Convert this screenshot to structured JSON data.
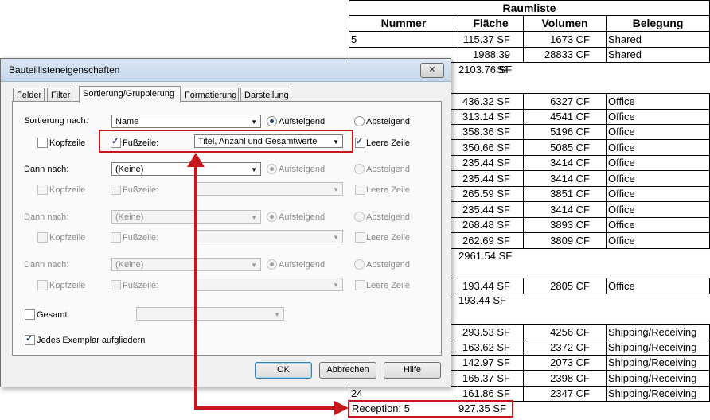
{
  "schedule": {
    "title": "Raumliste",
    "headers": [
      "Nummer",
      "Fläche",
      "Volumen",
      "Belegung"
    ],
    "rows": [
      {
        "nummer": "5",
        "flaeche": "115.37 SF",
        "volumen": "1673 CF",
        "belegung": "Shared"
      },
      {
        "nummer": "",
        "flaeche": "1988.39 SF",
        "volumen": "28833 CF",
        "belegung": "Shared"
      }
    ],
    "sum1": {
      "flaeche": "2103.76 SF"
    },
    "rows2": [
      {
        "nummer": "",
        "flaeche": "436.32 SF",
        "volumen": "6327 CF",
        "belegung": "Office"
      },
      {
        "nummer": "",
        "flaeche": "313.14 SF",
        "volumen": "4541 CF",
        "belegung": "Office"
      },
      {
        "nummer": "",
        "flaeche": "358.36 SF",
        "volumen": "5196 CF",
        "belegung": "Office"
      },
      {
        "nummer": "",
        "flaeche": "350.66 SF",
        "volumen": "5085 CF",
        "belegung": "Office"
      },
      {
        "nummer": "",
        "flaeche": "235.44 SF",
        "volumen": "3414 CF",
        "belegung": "Office"
      },
      {
        "nummer": "",
        "flaeche": "235.44 SF",
        "volumen": "3414 CF",
        "belegung": "Office"
      },
      {
        "nummer": "",
        "flaeche": "265.59 SF",
        "volumen": "3851 CF",
        "belegung": "Office"
      },
      {
        "nummer": "",
        "flaeche": "235.44 SF",
        "volumen": "3414 CF",
        "belegung": "Office"
      },
      {
        "nummer": "",
        "flaeche": "268.48 SF",
        "volumen": "3893 CF",
        "belegung": "Office"
      },
      {
        "nummer": "",
        "flaeche": "262.69 SF",
        "volumen": "3809 CF",
        "belegung": "Office"
      }
    ],
    "sum2": {
      "flaeche": "2961.54 SF"
    },
    "rows3": [
      {
        "nummer": "",
        "flaeche": "193.44 SF",
        "volumen": "2805 CF",
        "belegung": "Office"
      }
    ],
    "sum3": {
      "flaeche": "193.44 SF"
    },
    "rows4": [
      {
        "nummer": "",
        "flaeche": "293.53 SF",
        "volumen": "4256 CF",
        "belegung": "Shipping/Receiving"
      },
      {
        "nummer": "",
        "flaeche": "163.62 SF",
        "volumen": "2372 CF",
        "belegung": "Shipping/Receiving"
      },
      {
        "nummer": "",
        "flaeche": "142.97 SF",
        "volumen": "2073 CF",
        "belegung": "Shipping/Receiving"
      },
      {
        "nummer": "",
        "flaeche": "165.37 SF",
        "volumen": "2398 CF",
        "belegung": "Shipping/Receiving"
      },
      {
        "nummer": "24",
        "flaeche": "161.86 SF",
        "volumen": "2347 CF",
        "belegung": "Shipping/Receiving"
      }
    ],
    "sum4": {
      "label": "Reception: 5",
      "flaeche": "927.35 SF"
    }
  },
  "dialog": {
    "title": "Bauteillisteneigenschaften",
    "close_icon": "close-icon",
    "tabs": [
      "Felder",
      "Filter",
      "Sortierung/Gruppierung",
      "Formatierung",
      "Darstellung"
    ],
    "active_tab": "Sortierung/Gruppierung",
    "sort_label": "Sortierung nach:",
    "then_label": "Dann nach:",
    "header_label": "Kopfzeile",
    "footer_label": "Fußzeile:",
    "blank_label": "Leere Zeile",
    "asc_label": "Aufsteigend",
    "desc_label": "Absteigend",
    "sort1": {
      "field": "Name",
      "footer_checked": true,
      "header_checked": false,
      "blank_checked": true,
      "footer_option": "Titel, Anzahl und Gesamtwerte"
    },
    "none_option": "(Keine)",
    "grand_total_label": "Gesamt:",
    "itemize_label": "Jedes Exemplar aufgliedern",
    "ok_label": "OK",
    "cancel_label": "Abbrechen",
    "help_label": "Hilfe"
  },
  "colors": {
    "highlight": "#c8161d",
    "accent": "#3c7fb1"
  }
}
